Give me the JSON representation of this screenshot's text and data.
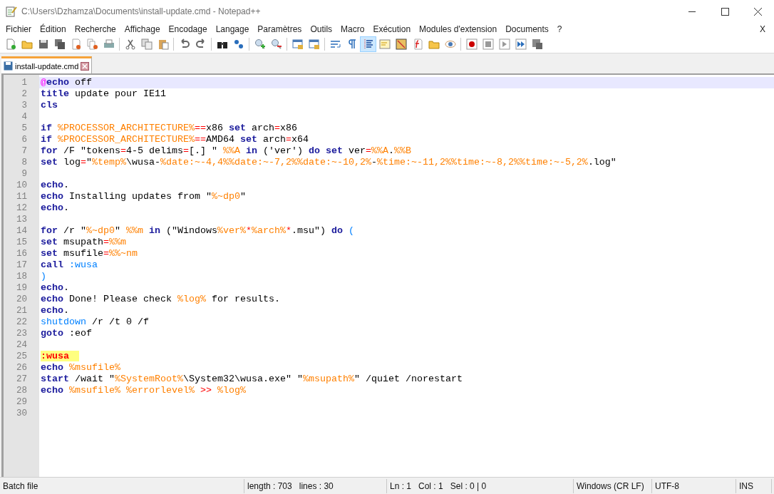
{
  "window": {
    "title": "C:\\Users\\Dzhamza\\Documents\\install-update.cmd - Notepad++"
  },
  "menu": {
    "items": [
      "Fichier",
      "Édition",
      "Recherche",
      "Affichage",
      "Encodage",
      "Langage",
      "Paramètres",
      "Outils",
      "Macro",
      "Exécution",
      "Modules d'extension",
      "Documents",
      "?"
    ],
    "close": "X"
  },
  "toolbar": [
    {
      "kind": "new",
      "pressed": false
    },
    {
      "kind": "open",
      "pressed": false
    },
    {
      "kind": "save",
      "pressed": false
    },
    {
      "kind": "saveall",
      "pressed": false
    },
    {
      "kind": "close",
      "pressed": false
    },
    {
      "kind": "closeall",
      "pressed": false
    },
    {
      "kind": "print",
      "pressed": false
    },
    {
      "kind": "separator"
    },
    {
      "kind": "cut",
      "pressed": false
    },
    {
      "kind": "copy",
      "pressed": false
    },
    {
      "kind": "paste",
      "pressed": false
    },
    {
      "kind": "separator"
    },
    {
      "kind": "undo",
      "pressed": false
    },
    {
      "kind": "redo",
      "pressed": false
    },
    {
      "kind": "separator"
    },
    {
      "kind": "find",
      "pressed": false
    },
    {
      "kind": "replace",
      "pressed": false
    },
    {
      "kind": "separator"
    },
    {
      "kind": "zoomin",
      "pressed": false
    },
    {
      "kind": "zoomout",
      "pressed": false
    },
    {
      "kind": "separator"
    },
    {
      "kind": "syncv",
      "pressed": false
    },
    {
      "kind": "synch",
      "pressed": false
    },
    {
      "kind": "separator"
    },
    {
      "kind": "wrap",
      "pressed": false
    },
    {
      "kind": "pilcrow",
      "pressed": false
    },
    {
      "kind": "indent",
      "pressed": true
    },
    {
      "kind": "folder",
      "pressed": false
    },
    {
      "kind": "map",
      "pressed": false
    },
    {
      "kind": "function",
      "pressed": false
    },
    {
      "kind": "workspace",
      "pressed": false
    },
    {
      "kind": "monitor",
      "pressed": false
    },
    {
      "kind": "separator"
    },
    {
      "kind": "record",
      "pressed": false
    },
    {
      "kind": "stop",
      "pressed": false
    },
    {
      "kind": "play",
      "pressed": false
    },
    {
      "kind": "playmulti",
      "pressed": false
    },
    {
      "kind": "savemacro",
      "pressed": false
    }
  ],
  "tabs": [
    {
      "label": "install-update.cmd",
      "selected": true
    }
  ],
  "lines": [
    {
      "number": "1",
      "current": true,
      "tokens": [
        {
          "kind": "at",
          "text": "@"
        },
        {
          "kind": "kw",
          "text": "echo"
        },
        {
          "kind": "txt",
          "text": " off"
        }
      ]
    },
    {
      "number": "2",
      "current": false,
      "tokens": [
        {
          "kind": "kw",
          "text": "title"
        },
        {
          "kind": "txt",
          "text": " update pour IE11"
        }
      ]
    },
    {
      "number": "3",
      "current": false,
      "tokens": [
        {
          "kind": "kw",
          "text": "cls"
        }
      ]
    },
    {
      "number": "4",
      "current": false
    },
    {
      "number": "5",
      "current": false,
      "tokens": [
        {
          "kind": "kw",
          "text": "if"
        },
        {
          "kind": "var",
          "text": " %PROCESSOR_ARCHITECTURE%"
        },
        {
          "kind": "op",
          "text": "=="
        },
        {
          "kind": "txt",
          "text": "x86 "
        },
        {
          "kind": "kw",
          "text": "set"
        },
        {
          "kind": "txt",
          "text": " arch"
        },
        {
          "kind": "op",
          "text": "="
        },
        {
          "kind": "txt",
          "text": "x86"
        }
      ]
    },
    {
      "number": "6",
      "current": false,
      "tokens": [
        {
          "kind": "kw",
          "text": "if"
        },
        {
          "kind": "var",
          "text": " %PROCESSOR_ARCHITECTURE%"
        },
        {
          "kind": "op",
          "text": "=="
        },
        {
          "kind": "txt",
          "text": "AMD64 "
        },
        {
          "kind": "kw",
          "text": "set"
        },
        {
          "kind": "txt",
          "text": " arch"
        },
        {
          "kind": "op",
          "text": "="
        },
        {
          "kind": "txt",
          "text": "x64"
        }
      ]
    },
    {
      "number": "7",
      "current": false,
      "tokens": [
        {
          "kind": "kw",
          "text": "for"
        },
        {
          "kind": "txt",
          "text": " /F \"tokens"
        },
        {
          "kind": "op",
          "text": "="
        },
        {
          "kind": "txt",
          "text": "4-5 delims"
        },
        {
          "kind": "op",
          "text": "="
        },
        {
          "kind": "txt",
          "text": "[.] \" "
        },
        {
          "kind": "var",
          "text": "%%A"
        },
        {
          "kind": "kw",
          "text": " in"
        },
        {
          "kind": "txt",
          "text": " ('ver') "
        },
        {
          "kind": "kw",
          "text": "do"
        },
        {
          "kind": "kw",
          "text": " set"
        },
        {
          "kind": "txt",
          "text": " ver"
        },
        {
          "kind": "op",
          "text": "="
        },
        {
          "kind": "var",
          "text": "%%A"
        },
        {
          "kind": "txt",
          "text": "."
        },
        {
          "kind": "var",
          "text": "%%B"
        }
      ]
    },
    {
      "number": "8",
      "current": false,
      "tokens": [
        {
          "kind": "kw",
          "text": "set"
        },
        {
          "kind": "txt",
          "text": " log"
        },
        {
          "kind": "op",
          "text": "="
        },
        {
          "kind": "txt",
          "text": "\""
        },
        {
          "kind": "var",
          "text": "%temp%"
        },
        {
          "kind": "txt",
          "text": "\\wusa-"
        },
        {
          "kind": "var",
          "text": "%date:~-4,4%%date:~-7,2%%date:~-10,2%"
        },
        {
          "kind": "txt",
          "text": "-"
        },
        {
          "kind": "var",
          "text": "%time:~-11,2%%time:~-8,2%%time:~-5,2%"
        },
        {
          "kind": "txt",
          "text": ".log\""
        }
      ]
    },
    {
      "number": "9",
      "current": false
    },
    {
      "number": "10",
      "current": false,
      "tokens": [
        {
          "kind": "kw",
          "text": "echo"
        },
        {
          "kind": "txt",
          "text": "."
        }
      ]
    },
    {
      "number": "11",
      "current": false,
      "tokens": [
        {
          "kind": "kw",
          "text": "echo"
        },
        {
          "kind": "txt",
          "text": " Installing updates from \""
        },
        {
          "kind": "var",
          "text": "%~dp0"
        },
        {
          "kind": "txt",
          "text": "\""
        }
      ]
    },
    {
      "number": "12",
      "current": false,
      "tokens": [
        {
          "kind": "kw",
          "text": "echo"
        },
        {
          "kind": "txt",
          "text": "."
        }
      ]
    },
    {
      "number": "13",
      "current": false
    },
    {
      "number": "14",
      "current": false,
      "tokens": [
        {
          "kind": "kw",
          "text": "for"
        },
        {
          "kind": "txt",
          "text": " /r \""
        },
        {
          "kind": "var",
          "text": "%~dp0"
        },
        {
          "kind": "txt",
          "text": "\" "
        },
        {
          "kind": "var",
          "text": "%%m"
        },
        {
          "kind": "kw",
          "text": " in"
        },
        {
          "kind": "txt",
          "text": " (\"Windows"
        },
        {
          "kind": "var",
          "text": "%ver%"
        },
        {
          "kind": "op",
          "text": "*"
        },
        {
          "kind": "var",
          "text": "%arch%"
        },
        {
          "kind": "op",
          "text": "*"
        },
        {
          "kind": "txt",
          "text": ".msu\") "
        },
        {
          "kind": "kw",
          "text": "do"
        },
        {
          "kind": "cmd",
          "text": " ("
        }
      ]
    },
    {
      "number": "15",
      "current": false,
      "tokens": [
        {
          "kind": "kw",
          "text": "set"
        },
        {
          "kind": "txt",
          "text": " msupath"
        },
        {
          "kind": "op",
          "text": "="
        },
        {
          "kind": "var",
          "text": "%%m"
        }
      ]
    },
    {
      "number": "16",
      "current": false,
      "tokens": [
        {
          "kind": "kw",
          "text": "set"
        },
        {
          "kind": "txt",
          "text": " msufile"
        },
        {
          "kind": "op",
          "text": "="
        },
        {
          "kind": "var",
          "text": "%%~nm"
        }
      ]
    },
    {
      "number": "17",
      "current": false,
      "tokens": [
        {
          "kind": "kw",
          "text": "call"
        },
        {
          "kind": "cmd",
          "text": " :wusa"
        }
      ]
    },
    {
      "number": "18",
      "current": false,
      "tokens": [
        {
          "kind": "cmd",
          "text": ")"
        }
      ]
    },
    {
      "number": "19",
      "current": false,
      "tokens": [
        {
          "kind": "kw",
          "text": "echo"
        },
        {
          "kind": "txt",
          "text": "."
        }
      ]
    },
    {
      "number": "20",
      "current": false,
      "tokens": [
        {
          "kind": "kw",
          "text": "echo"
        },
        {
          "kind": "txt",
          "text": " Done! Please check "
        },
        {
          "kind": "var",
          "text": "%log%"
        },
        {
          "kind": "txt",
          "text": " for results."
        }
      ]
    },
    {
      "number": "21",
      "current": false,
      "tokens": [
        {
          "kind": "kw",
          "text": "echo"
        },
        {
          "kind": "txt",
          "text": "."
        }
      ]
    },
    {
      "number": "22",
      "current": false,
      "tokens": [
        {
          "kind": "cmd",
          "text": "shutdown"
        },
        {
          "kind": "txt",
          "text": " /r /t 0 /f"
        }
      ]
    },
    {
      "number": "23",
      "current": false,
      "tokens": [
        {
          "kind": "kw",
          "text": "goto"
        },
        {
          "kind": "txt",
          "text": " :eof"
        }
      ]
    },
    {
      "number": "24",
      "current": false
    },
    {
      "number": "25",
      "current": false,
      "tokens": [
        {
          "kind": "label",
          "text": ":wusa"
        }
      ]
    },
    {
      "number": "26",
      "current": false,
      "tokens": [
        {
          "kind": "kw",
          "text": "echo"
        },
        {
          "kind": "var",
          "text": " %msufile%"
        }
      ]
    },
    {
      "number": "27",
      "current": false,
      "tokens": [
        {
          "kind": "kw",
          "text": "start"
        },
        {
          "kind": "txt",
          "text": " /wait \""
        },
        {
          "kind": "var",
          "text": "%SystemRoot%"
        },
        {
          "kind": "txt",
          "text": "\\System32\\wusa.exe\" \""
        },
        {
          "kind": "var",
          "text": "%msupath%"
        },
        {
          "kind": "txt",
          "text": "\" /quiet /norestart"
        }
      ]
    },
    {
      "number": "28",
      "current": false,
      "tokens": [
        {
          "kind": "kw",
          "text": "echo"
        },
        {
          "kind": "var",
          "text": " %msufile% %errorlevel%"
        },
        {
          "kind": "op",
          "text": " >>"
        },
        {
          "kind": "var",
          "text": " %log%"
        }
      ]
    },
    {
      "number": "29",
      "current": false
    },
    {
      "number": "30",
      "current": false
    }
  ],
  "status_bar": {
    "file_type": "Batch file",
    "length": "length : 703",
    "lines": "lines : 30",
    "ln": "Ln : 1",
    "col": "Col : 1",
    "sel": "Sel : 0 | 0",
    "eol": "Windows (CR LF)",
    "encoding": "UTF-8",
    "mode": "INS"
  }
}
